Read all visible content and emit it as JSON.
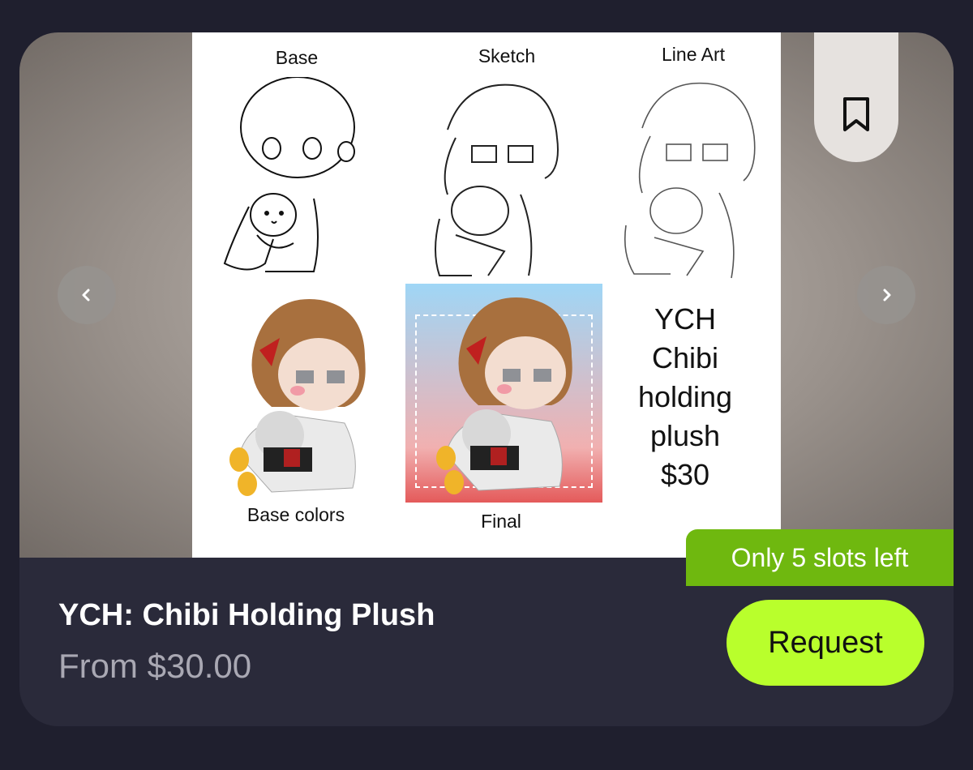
{
  "listing": {
    "title": "YCH: Chibi Holding Plush",
    "price": "From $30.00",
    "slots_badge": "Only 5 slots left",
    "request_label": "Request"
  },
  "artwork": {
    "labels": {
      "base": "Base",
      "sketch": "Sketch",
      "line_art": "Line Art",
      "base_colors": "Base colors",
      "final": "Final"
    },
    "ych_text": "YCH\nChibi\nholding\nplush\n$30"
  },
  "icons": {
    "prev": "chevron-left-icon",
    "next": "chevron-right-icon",
    "bookmark": "bookmark-icon"
  },
  "colors": {
    "page_bg": "#1f1f2e",
    "card_bg": "#2a2a3a",
    "slots_badge": "#6fb80f",
    "request_button": "#b9ff2c",
    "price_text": "#a9a8b3"
  }
}
